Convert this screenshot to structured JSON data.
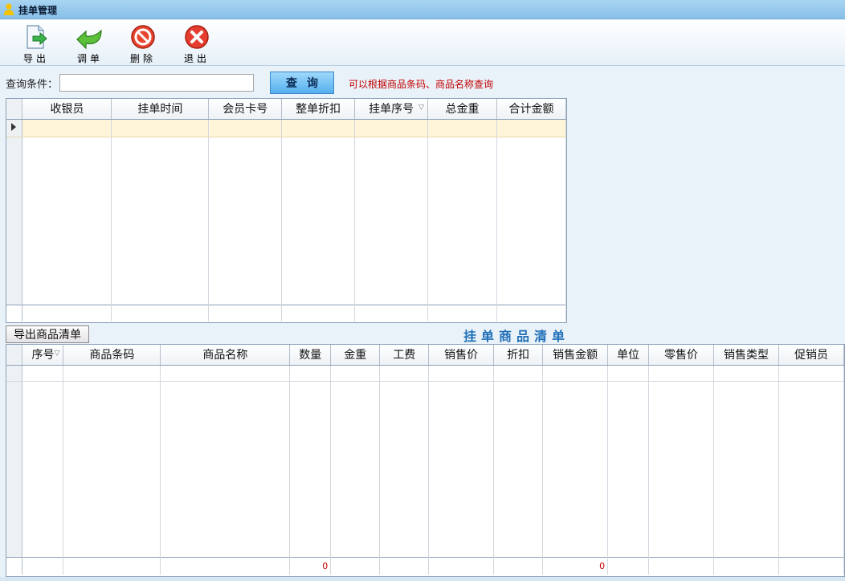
{
  "window": {
    "title": "挂单管理",
    "icon": "user-icon"
  },
  "toolbar": {
    "buttons": [
      {
        "label": "导出",
        "icon": "export-document-icon"
      },
      {
        "label": "调单",
        "icon": "recall-arrow-icon"
      },
      {
        "label": "删除",
        "icon": "no-entry-icon"
      },
      {
        "label": "退出",
        "icon": "close-x-icon"
      }
    ]
  },
  "query": {
    "label": "查询条件：",
    "value": "",
    "button": "查询",
    "hint": "可以根据商品条码、商品名称查询"
  },
  "orders_grid": {
    "columns": [
      "收银员",
      "挂单时间",
      "会员卡号",
      "整单折扣",
      "挂单序号",
      "总金重",
      "合计金额"
    ],
    "sorted_column": "挂单序号",
    "rows": []
  },
  "items": {
    "export_button": "导出商品清单",
    "title": "挂单商品清单",
    "columns": [
      "序号",
      "商品条码",
      "商品名称",
      "数量",
      "金重",
      "工费",
      "销售价",
      "折扣",
      "销售金额",
      "单位",
      "零售价",
      "销售类型",
      "促销员"
    ],
    "sorted_column": "序号",
    "rows": [],
    "totals": {
      "quantity": "0",
      "sale_amount": "0"
    }
  },
  "colors": {
    "title_bar": "#88c0e8",
    "query_button": "#55b0ef",
    "hint_text": "#c00000",
    "list_title": "#1f6fb8",
    "selected_row": "#fff5d9",
    "total_text": "#d00000"
  }
}
